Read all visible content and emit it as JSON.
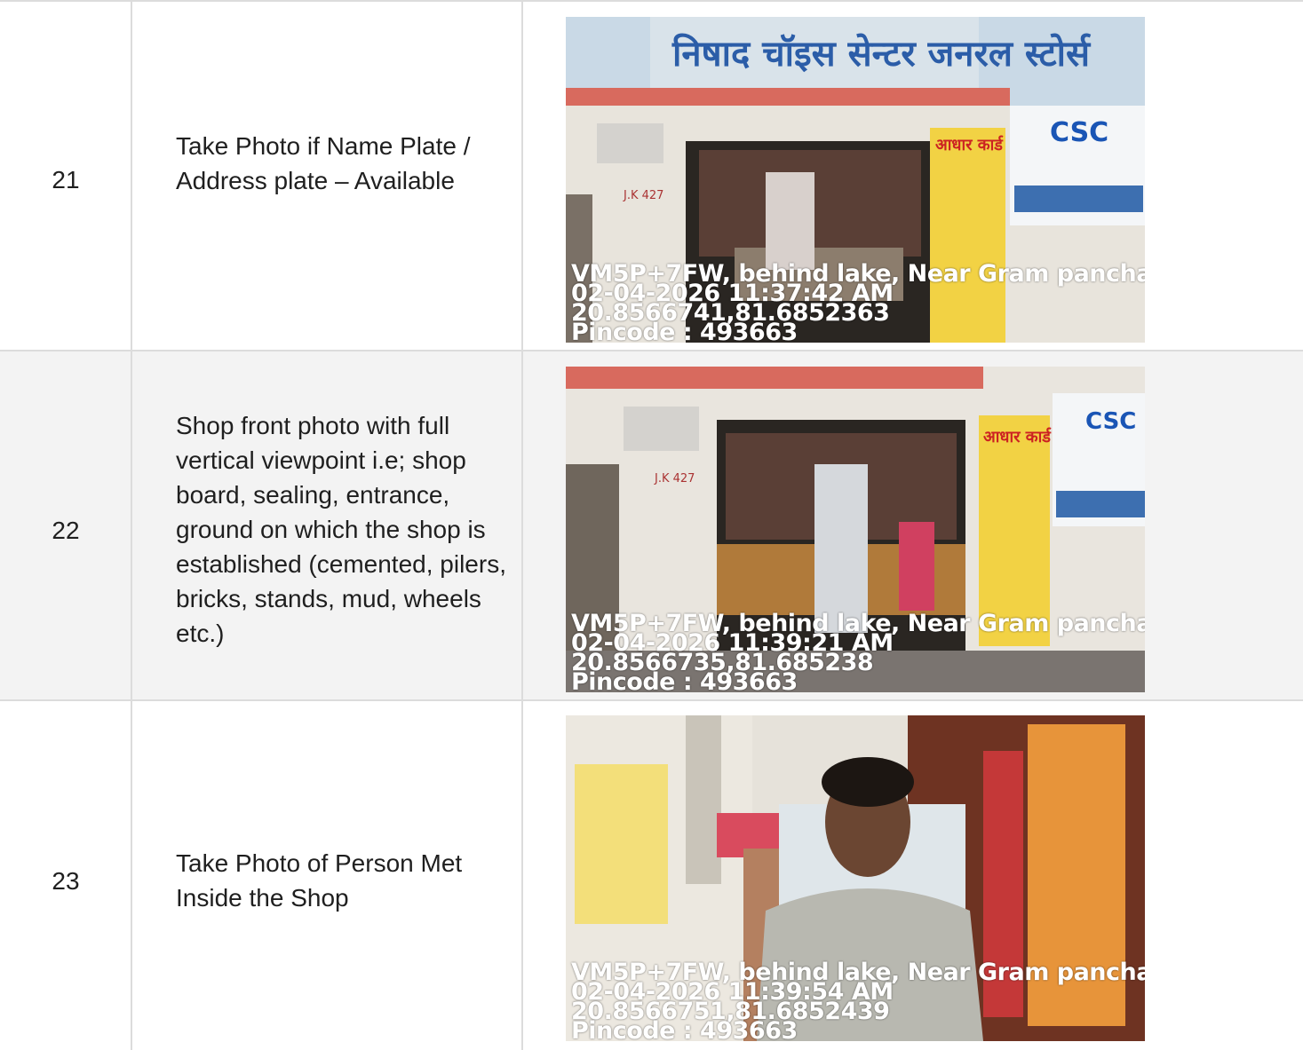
{
  "rows": [
    {
      "number": "21",
      "description": "Take Photo if Name Plate / Address plate – Available",
      "photo": {
        "address": "VM5P+7FW, behind lake, Near Gram panchay",
        "datetime": "02-04-2026 11:37:42 AM",
        "coords": "20.8566741,81.6852363",
        "pincode": "Pincode : 493663",
        "signboard": "निषाद चॉइस सेन्टर जनरल स्टोर्स",
        "wall_sign": "आधार कार्ड",
        "csc_label": "CSC",
        "door_text": "J.K 427"
      }
    },
    {
      "number": "22",
      "description": "Shop front photo with full vertical viewpoint i.e; shop board, sealing, entrance, ground on which the shop is established (cemented, pilers, bricks, stands, mud, wheels etc.)",
      "photo": {
        "address": "VM5P+7FW, behind lake, Near Gram panchay",
        "datetime": "02-04-2026 11:39:21 AM",
        "coords": "20.8566735,81.685238",
        "pincode": "Pincode : 493663",
        "wall_sign": "आधार कार्ड",
        "csc_label": "CSC",
        "door_text": "J.K 427"
      }
    },
    {
      "number": "23",
      "description": "Take Photo of Person Met Inside the Shop",
      "photo": {
        "address": "VM5P+7FW, behind lake, Near Gram panchay",
        "datetime": "02-04-2026 11:39:54 AM",
        "coords": "20.8566751,81.6852439",
        "pincode": "Pincode : 493663"
      }
    }
  ],
  "colors": {
    "border": "#dcdcdc",
    "row_alt": "#f3f3f3",
    "text": "#1f1f1f",
    "overlay_text": "#ffffff"
  }
}
